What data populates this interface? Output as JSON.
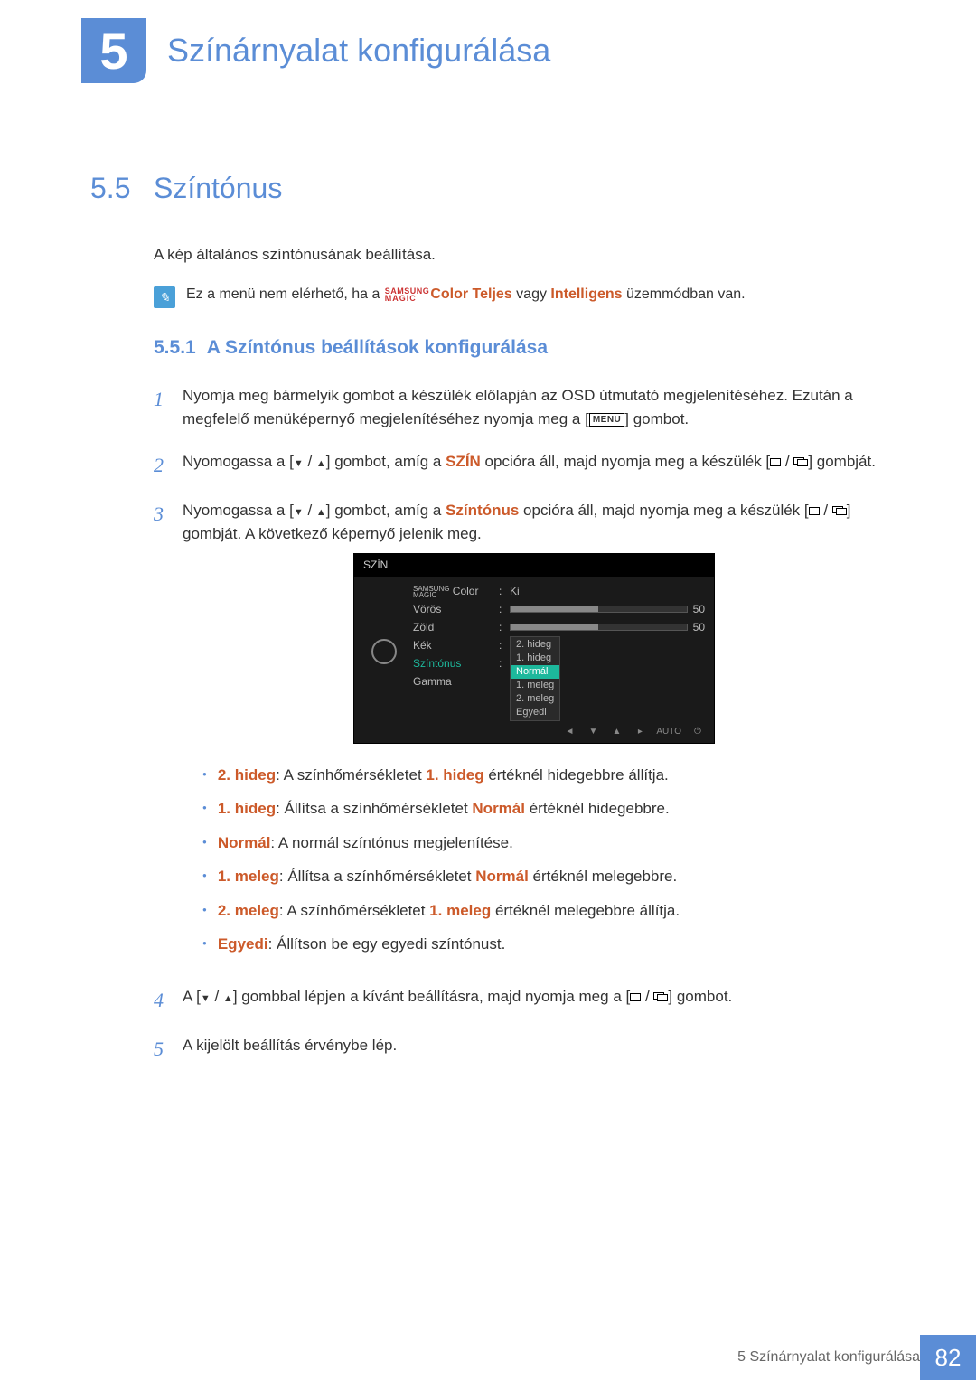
{
  "chapter": {
    "number": "5",
    "title": "Színárnyalat konfigurálása"
  },
  "section": {
    "number": "5.5",
    "title": "Színtónus"
  },
  "intro": "A kép általános színtónusának beállítása.",
  "note": {
    "pre": "Ez a menü nem elérhető, ha a ",
    "sm_top": "SAMSUNG",
    "sm_bot": "MAGIC",
    "color_word": "Color",
    "teljes": "Teljes",
    "mid": " vagy ",
    "intelligens": "Intelligens",
    "post": " üzemmódban van."
  },
  "subsection": {
    "number": "5.5.1",
    "title": "A Színtónus beállítások konfigurálása"
  },
  "steps": {
    "s1": {
      "n": "1",
      "a": "Nyomja meg bármelyik gombot a készülék előlapján az OSD útmutató megjelenítéséhez. Ezután a megfelelő menüképernyő megjelenítéséhez nyomja meg a [",
      "menu": "MENU",
      "b": "] gombot."
    },
    "s2": {
      "n": "2",
      "a": "Nyomogassa a [",
      "b": "] gombot, amíg a ",
      "szin": "SZÍN",
      "c": " opcióra áll, majd nyomja meg a készülék [",
      "d": "] gombját."
    },
    "s3": {
      "n": "3",
      "a": "Nyomogassa a [",
      "b": "] gombot, amíg a ",
      "szt": "Színtónus",
      "c": " opcióra áll, majd nyomja meg a készülék [",
      "d": "] gombját. A következő képernyő jelenik meg."
    },
    "s4": {
      "n": "4",
      "a": "A [",
      "b": "] gombbal lépjen a kívánt beállításra, majd nyomja meg a [",
      "c": "] gombot."
    },
    "s5": {
      "n": "5",
      "a": "A kijelölt beállítás érvénybe lép."
    }
  },
  "osd": {
    "title": "SZÍN",
    "labels": {
      "magic_top": "SAMSUNG",
      "magic_bot": "MAGIC",
      "magic_color": " Color",
      "voros": "Vörös",
      "zold": "Zöld",
      "kek": "Kék",
      "szintonus": "Színtónus",
      "gamma": "Gamma"
    },
    "vals": {
      "ki": "Ki",
      "v50a": "50",
      "v50b": "50"
    },
    "drop": {
      "o1": "2. hideg",
      "o2": "1. hideg",
      "o3": "Normál",
      "o4": "1. meleg",
      "o5": "2. meleg",
      "o6": "Egyedi"
    },
    "nav": {
      "auto": "AUTO"
    }
  },
  "bullets": {
    "b1": {
      "k": "2. hideg",
      "t1": ": A színhőmérsékletet ",
      "k2": "1. hideg",
      "t2": " értéknél hidegebbre állítja."
    },
    "b2": {
      "k": "1. hideg",
      "t1": ": Állítsa a színhőmérsékletet ",
      "k2": "Normál",
      "t2": " értéknél hidegebbre."
    },
    "b3": {
      "k": "Normál",
      "t1": ": A normál színtónus megjelenítése."
    },
    "b4": {
      "k": "1. meleg",
      "t1": ": Állítsa a színhőmérsékletet ",
      "k2": "Normál",
      "t2": " értéknél melegebbre."
    },
    "b5": {
      "k": "2. meleg",
      "t1": ": A színhőmérsékletet ",
      "k2": "1. meleg",
      "t2": " értéknél melegebbre állítja."
    },
    "b6": {
      "k": "Egyedi",
      "t1": ": Állítson be egy egyedi színtónust."
    }
  },
  "footer": {
    "text": "5 Színárnyalat konfigurálása",
    "page": "82"
  }
}
